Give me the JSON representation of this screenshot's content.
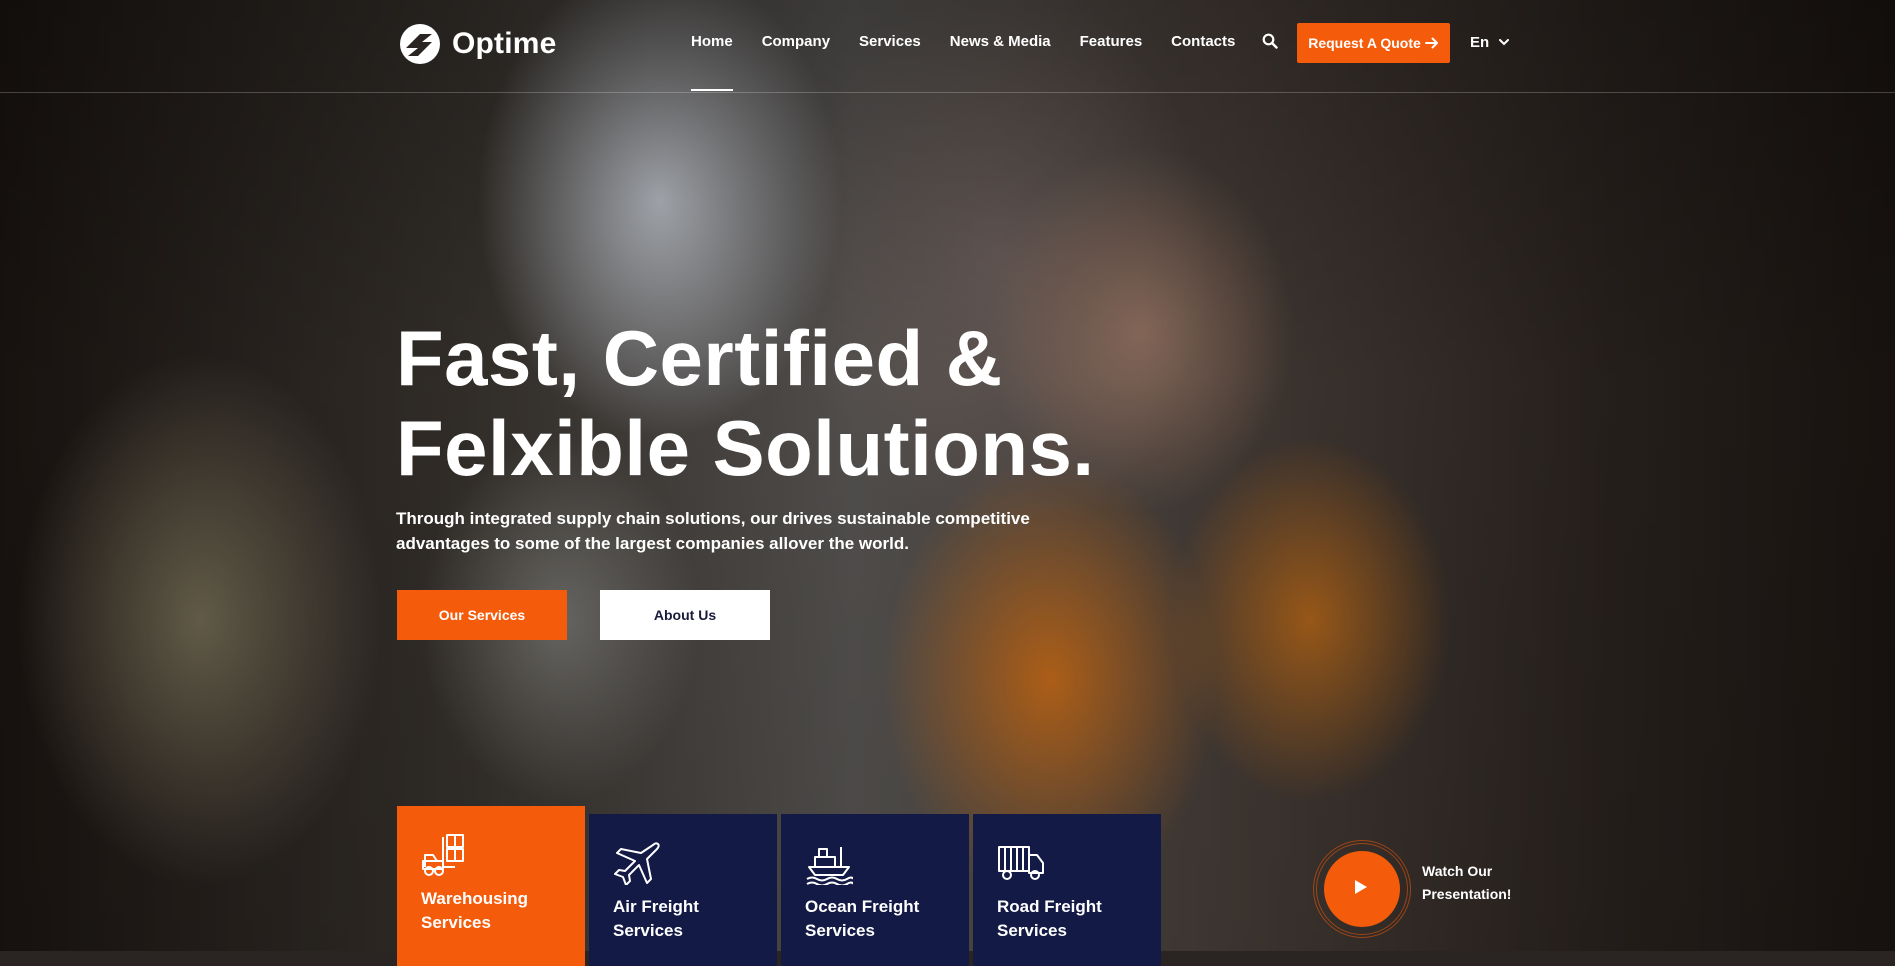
{
  "brand": {
    "name": "Optime"
  },
  "nav": {
    "items": [
      {
        "label": "Home",
        "active": true
      },
      {
        "label": "Company",
        "active": false
      },
      {
        "label": "Services",
        "active": false
      },
      {
        "label": "News & Media",
        "active": false
      },
      {
        "label": "Features",
        "active": false
      },
      {
        "label": "Contacts",
        "active": false
      }
    ],
    "quote_label": "Request A Quote",
    "language": "En"
  },
  "hero": {
    "title_line1": "Fast, Certified &",
    "title_line2": "Felxible Solutions.",
    "subtitle": "Through integrated supply chain solutions, our drives sustainable competitive advantages to some of the largest companies allover the world.",
    "primary_button": "Our Services",
    "secondary_button": "About Us"
  },
  "services": [
    {
      "label": "Warehousing Services",
      "icon": "forklift-icon",
      "active": true
    },
    {
      "label": "Air Freight Services",
      "icon": "airplane-icon",
      "active": false
    },
    {
      "label": "Ocean Freight Services",
      "icon": "ship-icon",
      "active": false
    },
    {
      "label": "Road Freight Services",
      "icon": "truck-icon",
      "active": false
    }
  ],
  "presentation": {
    "label": "Watch Our Presentation!"
  },
  "colors": {
    "accent": "#f45b0a",
    "navy": "#121a45",
    "white": "#ffffff"
  }
}
